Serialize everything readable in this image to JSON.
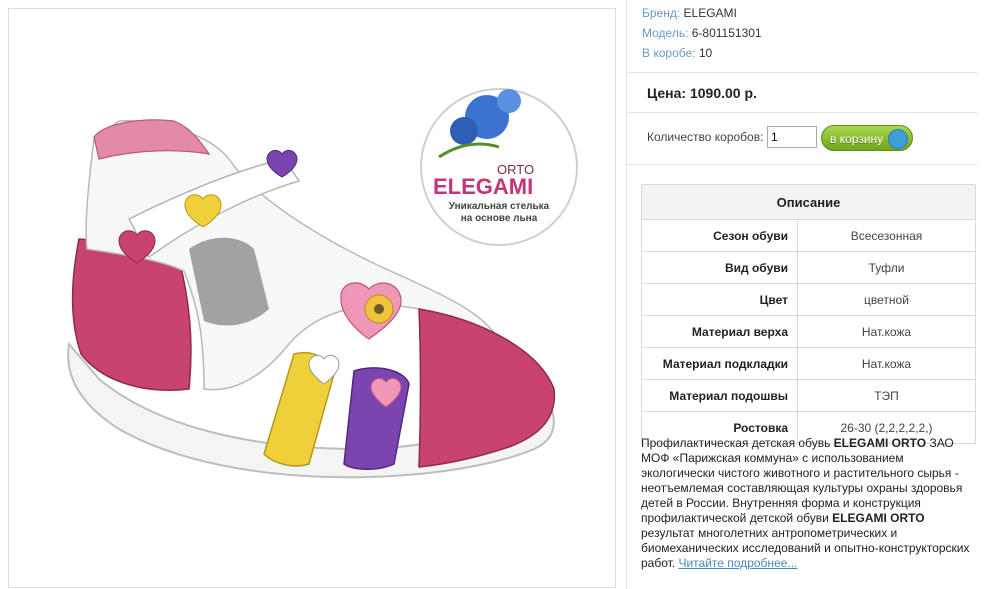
{
  "product": {
    "brand": {
      "label": "Бренд:",
      "value": "ELEGAMI"
    },
    "model": {
      "label": "Модель:",
      "value": "6-801151301"
    },
    "box": {
      "label": "В коробе:",
      "value": "10"
    }
  },
  "price": {
    "text": "Цена: 1090.00 р."
  },
  "order": {
    "qty_label": "Количество коробов:",
    "qty_value": "1",
    "cart_button": "в корзину"
  },
  "badge": {
    "orto": "ORTO",
    "brand": "ELEGAMI",
    "line1": "Уникальная стелька",
    "line2": "на основе льна"
  },
  "description": {
    "header": "Описание",
    "rows": [
      {
        "key": "Сезон обуви",
        "value": "Всесезонная"
      },
      {
        "key": "Вид обуви",
        "value": "Туфли"
      },
      {
        "key": "Цвет",
        "value": "цветной"
      },
      {
        "key": "Материал верха",
        "value": "Нат.кожа"
      },
      {
        "key": "Материал подкладки",
        "value": "Нат.кожа"
      },
      {
        "key": "Материал подошвы",
        "value": "ТЭП"
      },
      {
        "key": "Ростовка",
        "value": "26-30 (2,2,2,2,2,)"
      }
    ],
    "text_1": "Профилактическая детская обувь ",
    "brand_1": "ELEGAMI ORTO",
    "text_2": " ЗАО МОФ «Парижская коммуна» с использованием экологически чистого животного и растительного сырья - неотъемлемая составляющая культуры охраны здоровья детей в России. Внутренняя форма и конструкция профилактической детской обуви ",
    "brand_2": "ELEGAMI ORTO",
    "text_3": " результат многолетних антропометрических и биомеханических исследований и опытно-конструкторских работ. ",
    "read_more": "Читайте подробнее..."
  },
  "colors": {
    "link": "#4a88c2",
    "label": "#6a9bc6",
    "button": "#7ab52a",
    "pink": "#c23d6e"
  }
}
